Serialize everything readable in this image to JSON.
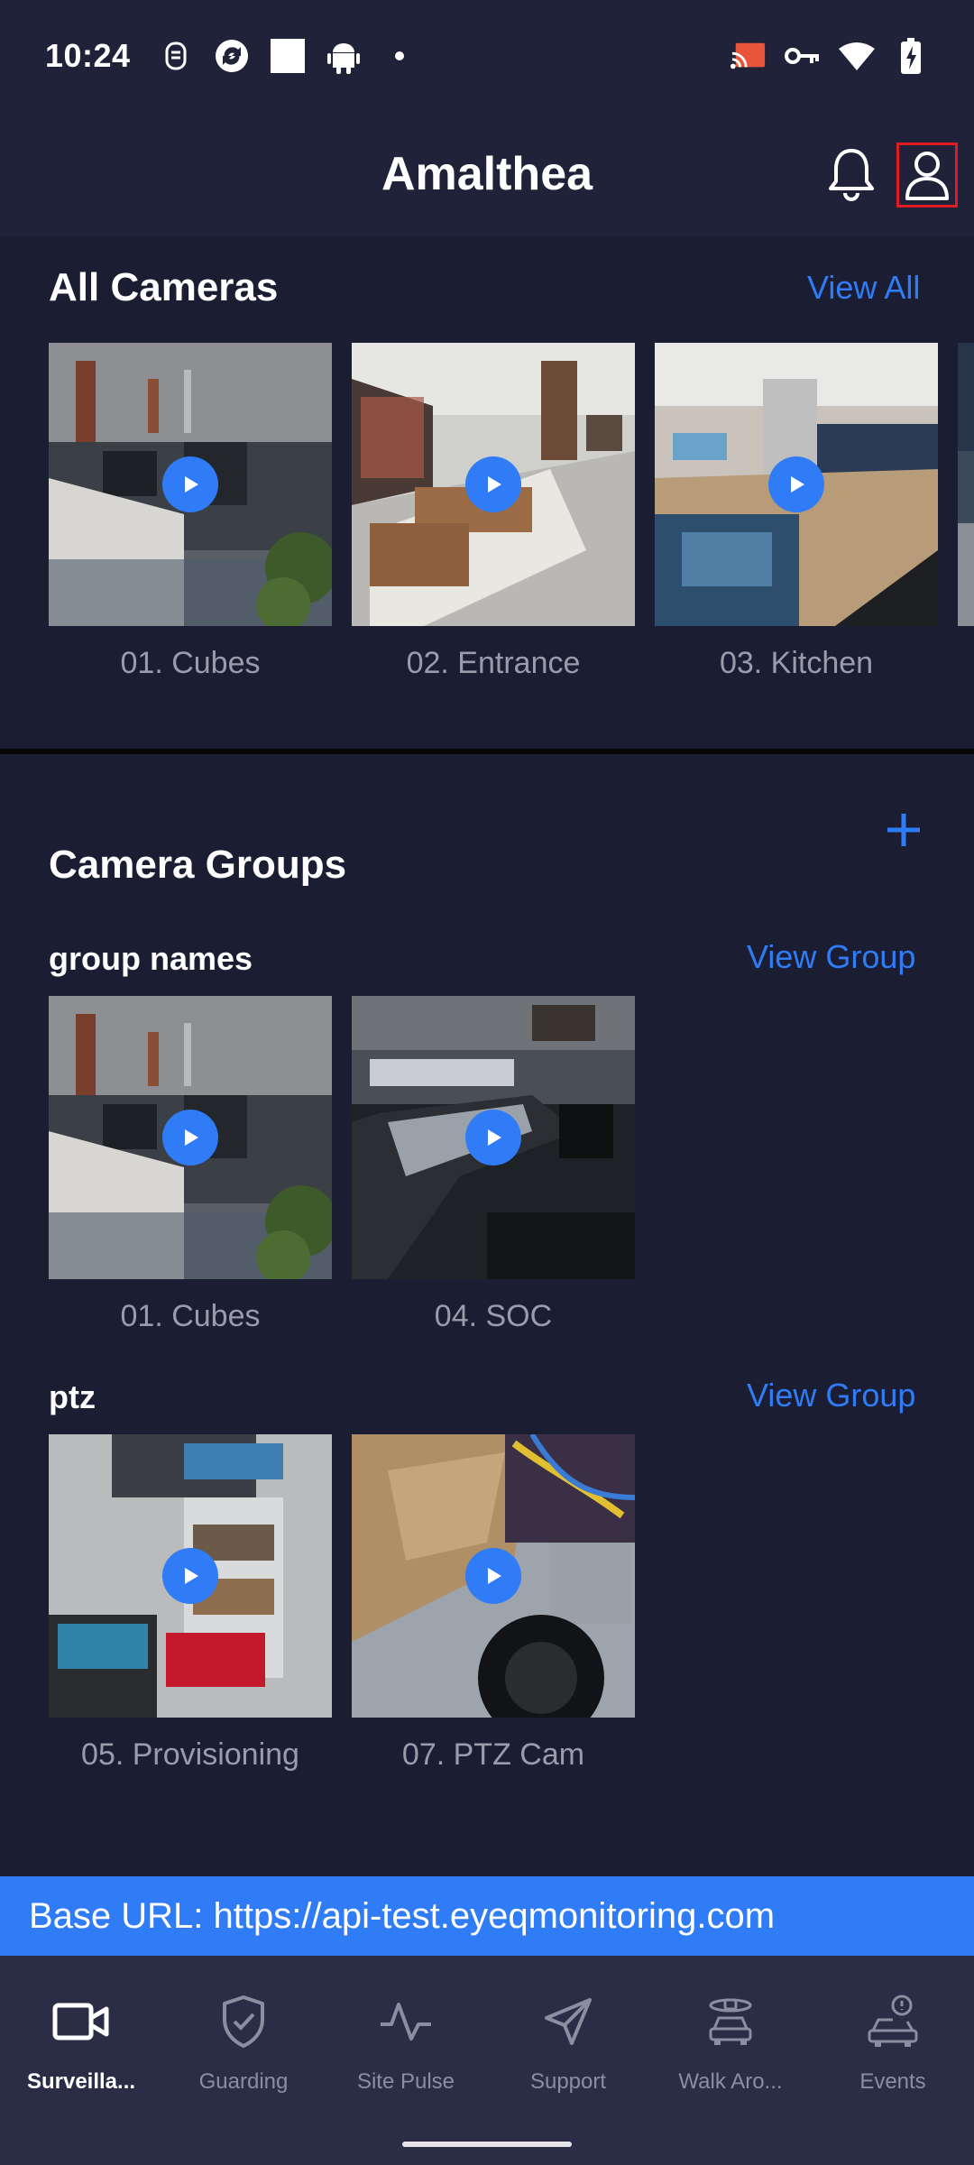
{
  "status_bar": {
    "time": "10:24",
    "icons_left": [
      "cellular-rec-icon",
      "sync-icon",
      "square-icon",
      "android-icon",
      "dot-icon"
    ],
    "icons_right": [
      "cast-icon",
      "vpn-key-icon",
      "wifi-icon",
      "battery-charging-icon"
    ]
  },
  "header": {
    "title": "Amalthea",
    "bell_icon": "bell-icon",
    "profile_icon": "profile-icon"
  },
  "all_cameras": {
    "heading": "All Cameras",
    "view_all": "View All",
    "cameras": [
      {
        "label": "01. Cubes"
      },
      {
        "label": "02. Entrance"
      },
      {
        "label": "03. Kitchen"
      }
    ]
  },
  "camera_groups": {
    "heading": "Camera Groups",
    "add_icon": "plus-icon",
    "groups": [
      {
        "name": "group names",
        "view_label": "View Group",
        "cameras": [
          {
            "label": "01. Cubes"
          },
          {
            "label": "04. SOC"
          }
        ]
      },
      {
        "name": "ptz",
        "view_label": "View Group",
        "cameras": [
          {
            "label": "05. Provisioning"
          },
          {
            "label": "07. PTZ Cam"
          }
        ]
      }
    ]
  },
  "banner": {
    "base_url": "Base URL: https://api-test.eyeqmonitoring.com"
  },
  "bottom_nav": {
    "items": [
      {
        "label": "Surveilla...",
        "icon": "video-camera-icon",
        "active": true
      },
      {
        "label": "Guarding",
        "icon": "shield-check-icon",
        "active": false
      },
      {
        "label": "Site Pulse",
        "icon": "pulse-icon",
        "active": false
      },
      {
        "label": "Support",
        "icon": "send-icon",
        "active": false
      },
      {
        "label": "Walk Aro...",
        "icon": "car-scan-icon",
        "active": false
      },
      {
        "label": "Events",
        "icon": "car-alert-icon",
        "active": false
      }
    ]
  },
  "colors": {
    "background": "#1b1d32",
    "header": "#1f2238",
    "accent": "#2f7cf6",
    "caption": "#9a9cab",
    "nav": "#2a2d45"
  }
}
